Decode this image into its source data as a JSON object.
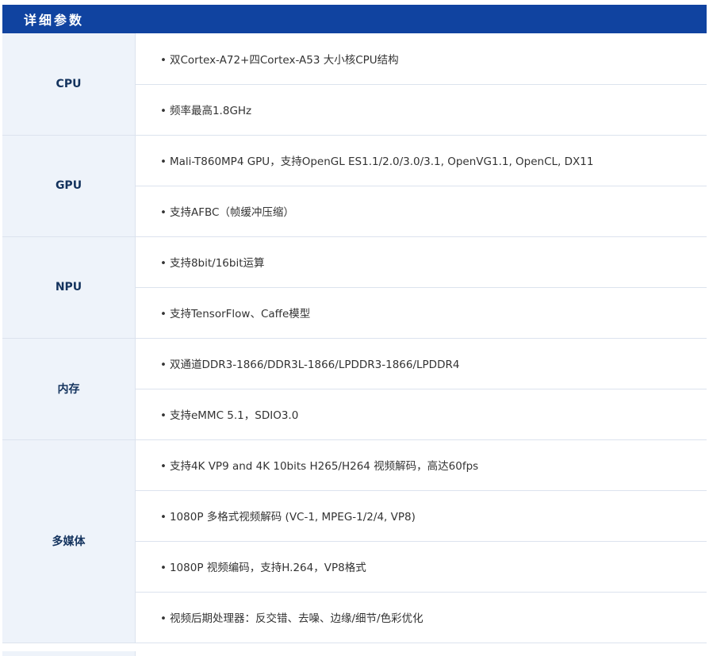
{
  "header": {
    "title": "详细参数"
  },
  "specs": [
    {
      "category": "CPU",
      "items": [
        "双Cortex-A72+四Cortex-A53 大小核CPU结构",
        "频率最高1.8GHz"
      ]
    },
    {
      "category": "GPU",
      "items": [
        "Mali-T860MP4 GPU，支持OpenGL ES1.1/2.0/3.0/3.1, OpenVG1.1, OpenCL, DX11",
        "支持AFBC（帧缓冲压缩）"
      ]
    },
    {
      "category": "NPU",
      "items": [
        "支持8bit/16bit运算",
        "支持TensorFlow、Caffe模型"
      ]
    },
    {
      "category": "内存",
      "items": [
        "双通道DDR3-1866/DDR3L-1866/LPDDR3-1866/LPDDR4",
        "支持eMMC 5.1，SDIO3.0"
      ]
    },
    {
      "category": "多媒体",
      "items": [
        "支持4K VP9 and 4K 10bits H265/H264 视频解码，高达60fps",
        "1080P 多格式视频解码 (VC-1, MPEG-1/2/4, VP8)",
        "1080P 视频编码，支持H.264，VP8格式",
        "视频后期处理器：反交错、去噪、边缘/细节/色彩优化"
      ]
    }
  ]
}
